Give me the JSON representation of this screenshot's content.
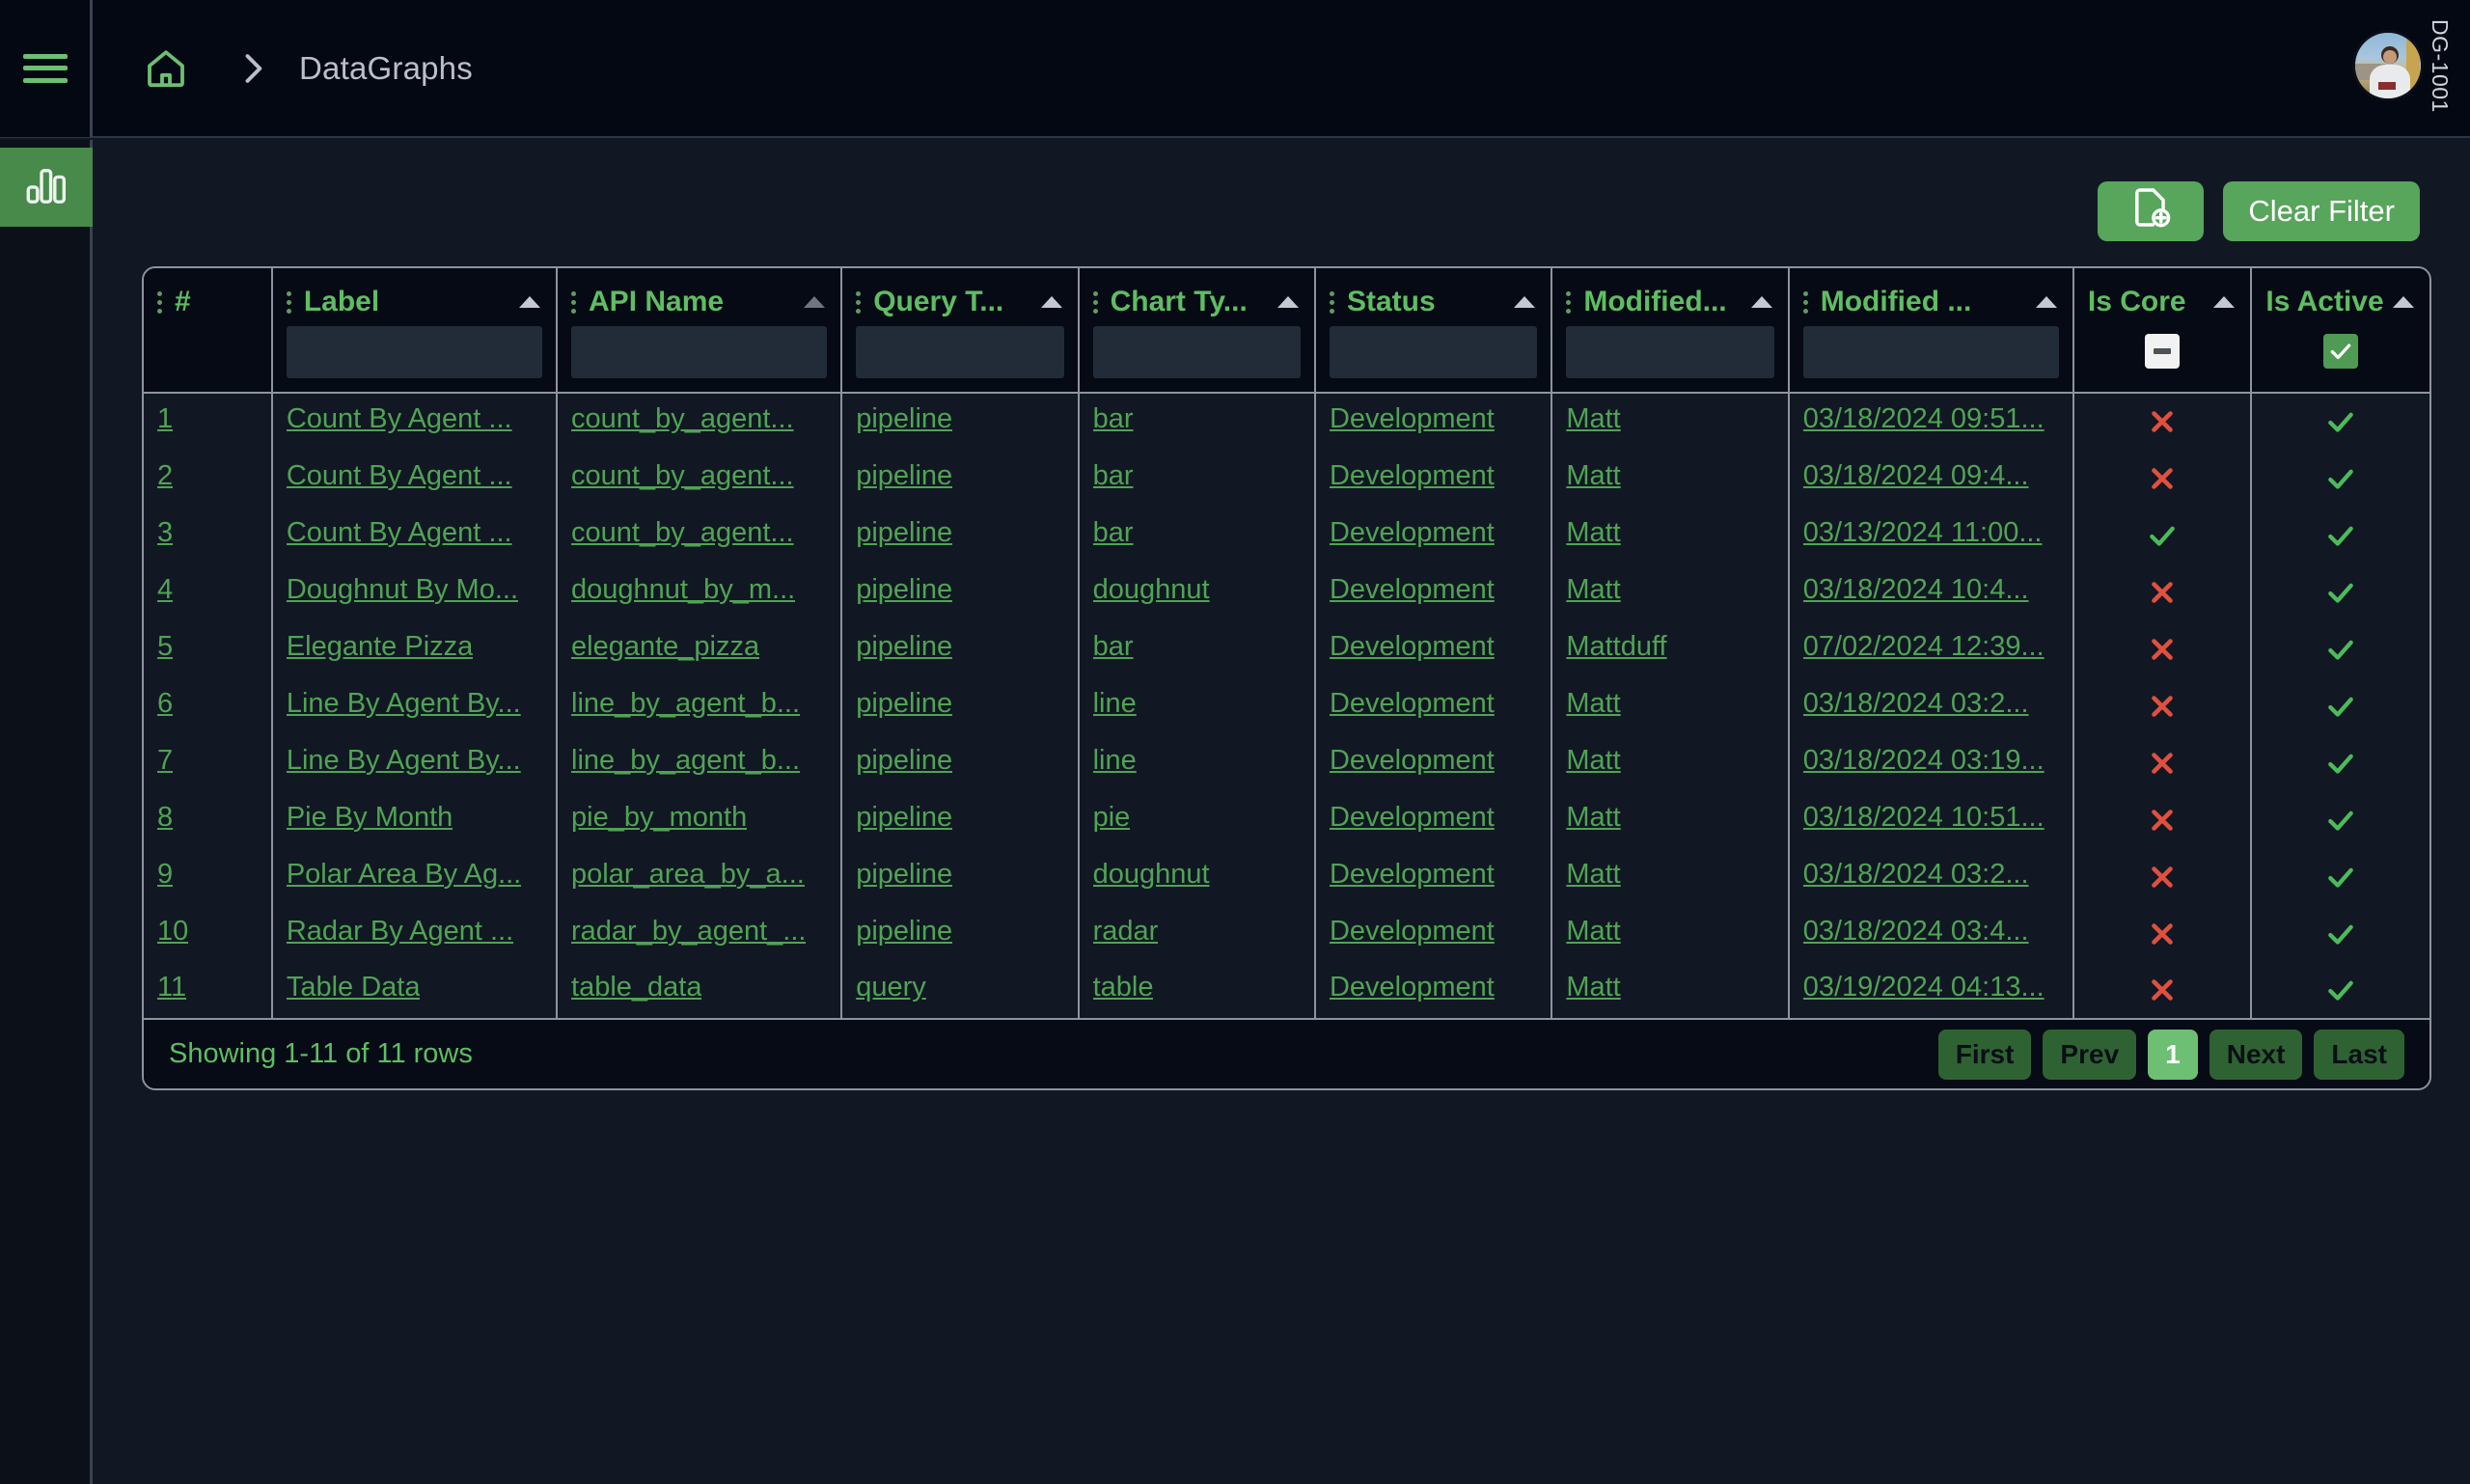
{
  "topbar": {
    "menu_icon": "hamburger-icon",
    "home_icon": "home-icon",
    "separator_icon": "chevron-right-icon",
    "breadcrumb": "DataGraphs",
    "user_tag": "DG-1001",
    "avatar": "user-avatar"
  },
  "rail": {
    "items": [
      {
        "icon": "bar-chart-icon",
        "label": "DataGraphs"
      }
    ]
  },
  "actions": {
    "new_icon": "new-document-icon",
    "clear_filter_label": "Clear Filter"
  },
  "table": {
    "columns": [
      {
        "label": "#",
        "sortable": false,
        "filter": "none",
        "width": 72
      },
      {
        "label": "Label",
        "sortable": true,
        "filter": "text",
        "width": 160
      },
      {
        "label": "API Name",
        "sortable": true,
        "filter": "text",
        "width": 160
      },
      {
        "label": "Query T...",
        "sortable": true,
        "filter": "text",
        "width": 133
      },
      {
        "label": "Chart Ty...",
        "sortable": true,
        "filter": "text",
        "width": 133
      },
      {
        "label": "Status",
        "sortable": true,
        "filter": "text",
        "width": 133
      },
      {
        "label": "Modified...",
        "sortable": true,
        "filter": "text",
        "width": 133
      },
      {
        "label": "Modified ...",
        "sortable": true,
        "filter": "text",
        "width": 160
      },
      {
        "label": "Is Core",
        "sortable": true,
        "filter": "checkbox-indeterminate",
        "width": 100
      },
      {
        "label": "Is Active",
        "sortable": true,
        "filter": "checkbox-checked",
        "width": 100
      }
    ],
    "filter_values": [
      "",
      "",
      "",
      "",
      "",
      "",
      "",
      "",
      "",
      ""
    ],
    "filter_placeholders": [
      "",
      "",
      "",
      "",
      "",
      "",
      "",
      "",
      "",
      ""
    ],
    "rows": [
      {
        "num": "1",
        "label": "Count By Agent ...",
        "api_name": "count_by_agent...",
        "query_type": "pipeline",
        "chart_type": "bar",
        "status": "Development",
        "modified_by": "Matt",
        "modified_date": "03/18/2024 09:51...",
        "is_core": false,
        "is_active": true
      },
      {
        "num": "2",
        "label": "Count By Agent ...",
        "api_name": "count_by_agent...",
        "query_type": "pipeline",
        "chart_type": "bar",
        "status": "Development",
        "modified_by": "Matt",
        "modified_date": "03/18/2024 09:4...",
        "is_core": false,
        "is_active": true
      },
      {
        "num": "3",
        "label": "Count By Agent ...",
        "api_name": "count_by_agent...",
        "query_type": "pipeline",
        "chart_type": "bar",
        "status": "Development",
        "modified_by": "Matt",
        "modified_date": "03/13/2024 11:00...",
        "is_core": true,
        "is_active": true
      },
      {
        "num": "4",
        "label": "Doughnut By Mo...",
        "api_name": "doughnut_by_m...",
        "query_type": "pipeline",
        "chart_type": "doughnut",
        "status": "Development",
        "modified_by": "Matt",
        "modified_date": "03/18/2024 10:4...",
        "is_core": false,
        "is_active": true
      },
      {
        "num": "5",
        "label": "Elegante Pizza",
        "api_name": "elegante_pizza",
        "query_type": "pipeline",
        "chart_type": "bar",
        "status": "Development",
        "modified_by": "Mattduff",
        "modified_date": "07/02/2024 12:39...",
        "is_core": false,
        "is_active": true
      },
      {
        "num": "6",
        "label": "Line By Agent By...",
        "api_name": "line_by_agent_b...",
        "query_type": "pipeline",
        "chart_type": "line",
        "status": "Development",
        "modified_by": "Matt",
        "modified_date": "03/18/2024 03:2...",
        "is_core": false,
        "is_active": true
      },
      {
        "num": "7",
        "label": "Line By Agent By...",
        "api_name": "line_by_agent_b...",
        "query_type": "pipeline",
        "chart_type": "line",
        "status": "Development",
        "modified_by": "Matt",
        "modified_date": "03/18/2024 03:19...",
        "is_core": false,
        "is_active": true
      },
      {
        "num": "8",
        "label": "Pie By Month",
        "api_name": "pie_by_month",
        "query_type": "pipeline",
        "chart_type": "pie",
        "status": "Development",
        "modified_by": "Matt",
        "modified_date": "03/18/2024 10:51...",
        "is_core": false,
        "is_active": true
      },
      {
        "num": "9",
        "label": "Polar Area By Ag...",
        "api_name": "polar_area_by_a...",
        "query_type": "pipeline",
        "chart_type": "doughnut",
        "status": "Development",
        "modified_by": "Matt",
        "modified_date": "03/18/2024 03:2...",
        "is_core": false,
        "is_active": true
      },
      {
        "num": "10",
        "label": "Radar By Agent ...",
        "api_name": "radar_by_agent_...",
        "query_type": "pipeline",
        "chart_type": "radar",
        "status": "Development",
        "modified_by": "Matt",
        "modified_date": "03/18/2024 03:4...",
        "is_core": false,
        "is_active": true
      },
      {
        "num": "11",
        "label": "Table Data",
        "api_name": "table_data",
        "query_type": "query",
        "chart_type": "table",
        "status": "Development",
        "modified_by": "Matt",
        "modified_date": "03/19/2024 04:13...",
        "is_core": false,
        "is_active": true
      }
    ]
  },
  "footer": {
    "showing": "Showing 1-11 of 11 rows",
    "pager": [
      {
        "label": "First",
        "active": false
      },
      {
        "label": "Prev",
        "active": false
      },
      {
        "label": "1",
        "active": true
      },
      {
        "label": "Next",
        "active": false
      },
      {
        "label": "Last",
        "active": false
      }
    ]
  },
  "colors": {
    "accent_green": "#58a55c",
    "link_green": "#51a355",
    "header_green": "#5fbd63",
    "danger_red": "#e0503f",
    "page_bg": "#111823",
    "bar_bg": "#040812",
    "border": "#8d949e"
  }
}
